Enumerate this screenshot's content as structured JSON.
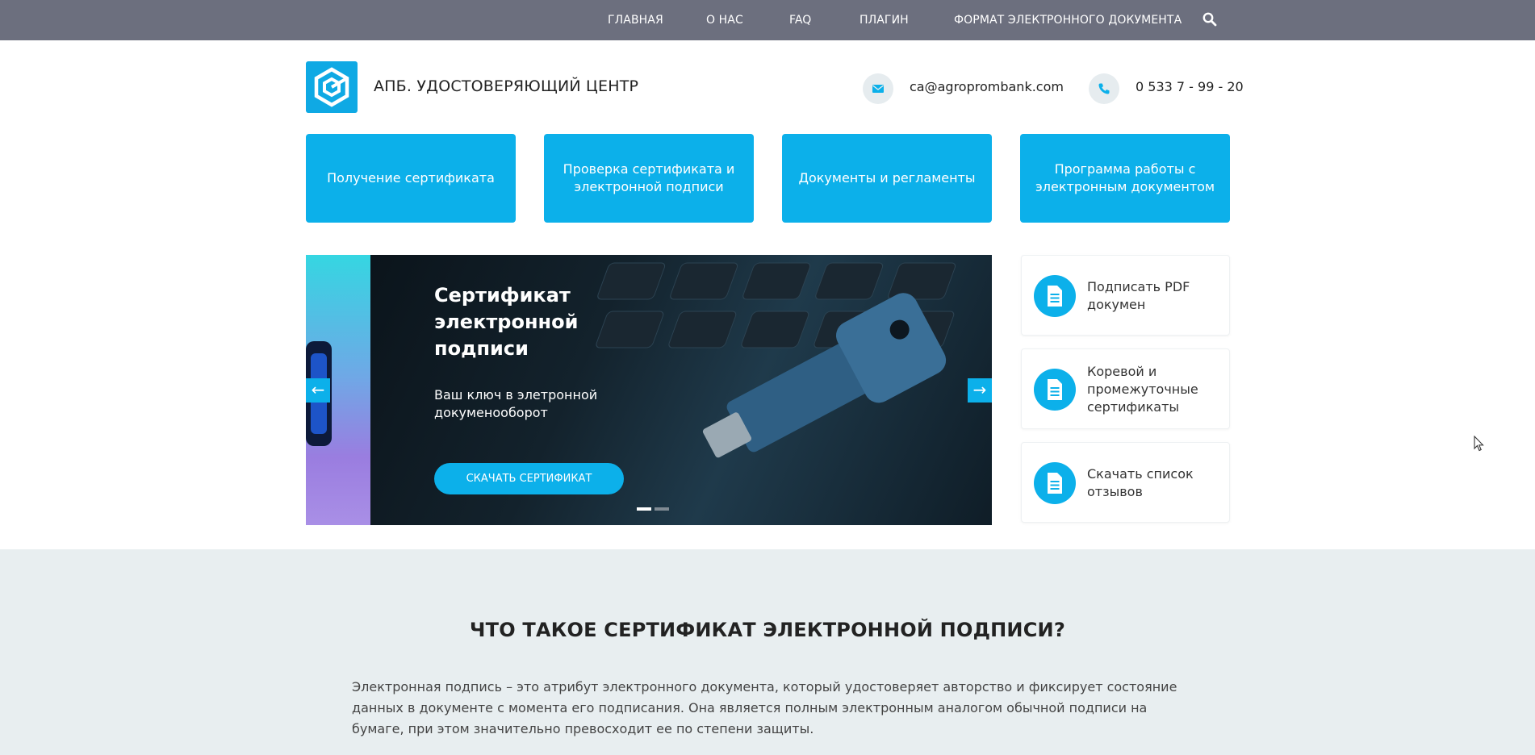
{
  "topnav": {
    "items": [
      "ГЛАВНАЯ",
      "О НАС",
      "FAQ",
      "ПЛАГИН",
      "ФОРМАТ ЭЛЕКТРОННОГО ДОКУМЕНТА"
    ],
    "search_icon": "search-icon"
  },
  "header": {
    "brand": "АПБ. УДОСТОВЕРЯЮЩИЙ ЦЕНТР",
    "email": "ca@agroprombank.com",
    "phone": "0 533 7 - 99 - 20"
  },
  "services": [
    "Получение сертификата",
    "Проверка сертификата и электронной подписи",
    "Документы и регламенты",
    "Программа работы с электронным документом"
  ],
  "slider": {
    "title": "Сертификат электронной подписи",
    "subtitle": "Ваш ключ в элетронной докуменооборот",
    "button": "СКАЧАТЬ СЕРТИФИКАТ",
    "prev": "←",
    "next": "→"
  },
  "cards": [
    "Подписать PDF докумен",
    "Коревой и промежуточные сертификаты",
    "Скачать список отзывов"
  ],
  "info": {
    "heading": "ЧТО ТАКОЕ СЕРТИФИКАТ ЭЛЕКТРОННОЙ ПОДПИСИ?",
    "text": "Электронная подпись – это атрибут электронного документа, который удостоверяет авторство и фиксирует состояние данных в документе с момента его подписания. Она является полным электронным аналогом обычной подписи на бумаге, при этом значительно превосходит ее по степени защиты."
  },
  "colors": {
    "nav_bg": "#6c6f7e",
    "accent": "#0cb0ea",
    "section_bg": "#e8eef0"
  }
}
